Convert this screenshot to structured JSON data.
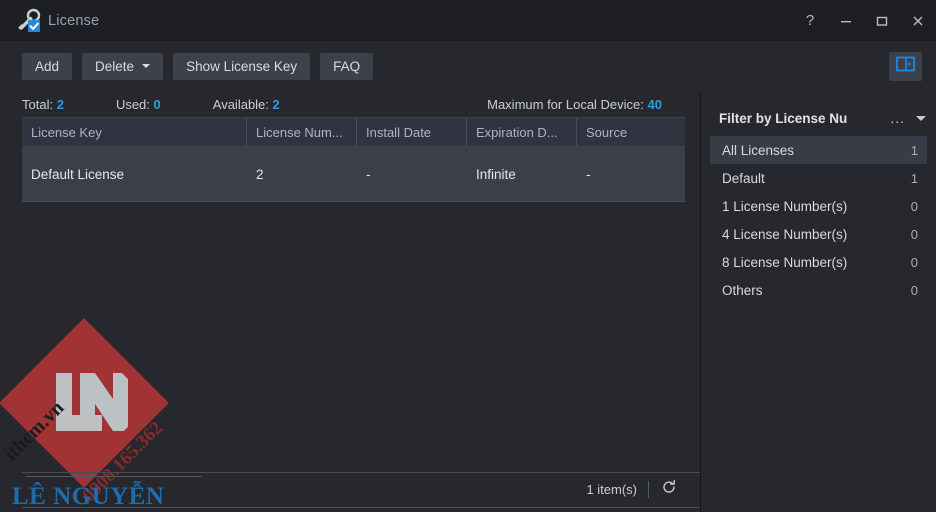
{
  "window": {
    "title": "License",
    "icon": "key-check-icon",
    "controls": {
      "help": "?",
      "minimize": "—",
      "maximize": "□",
      "close": "✕"
    }
  },
  "toolbar": {
    "add_label": "Add",
    "delete_label": "Delete",
    "show_license_key_label": "Show License Key",
    "faq_label": "FAQ",
    "panel_toggle_icon": "side-panel-toggle-icon"
  },
  "stats": [
    {
      "label": "Total:",
      "value": "2"
    },
    {
      "label": "Used:",
      "value": "0"
    },
    {
      "label": "Available:",
      "value": "2"
    },
    {
      "label": "Maximum for Local Device:",
      "value": "40"
    }
  ],
  "table": {
    "columns": [
      "License Key",
      "License Num...",
      "Install Date",
      "Expiration D...",
      "Source"
    ],
    "rows": [
      {
        "license_key": "Default License",
        "license_number": "2",
        "install_date": "-",
        "expiration_date": "Infinite",
        "source": "-"
      }
    ]
  },
  "filter_panel": {
    "title": "Filter by License Nu",
    "overflow": "...",
    "items": [
      {
        "label": "All Licenses",
        "count": "1",
        "selected": true
      },
      {
        "label": "Default",
        "count": "1",
        "selected": false
      },
      {
        "label": "1 License Number(s)",
        "count": "0",
        "selected": false
      },
      {
        "label": "4 License Number(s)",
        "count": "0",
        "selected": false
      },
      {
        "label": "8 License Number(s)",
        "count": "0",
        "selected": false
      },
      {
        "label": "Others",
        "count": "0",
        "selected": false
      }
    ]
  },
  "footer": {
    "count_label": "1 item(s)",
    "refresh_icon": "refresh-icon"
  },
  "watermark": {
    "monogram": "LN",
    "site": "ithcm.vn",
    "phone": "0908.165.362",
    "brand": "LÊ NGUYỄN"
  },
  "colors": {
    "accent_blue": "#2a9fe0",
    "titlebar": "#1d1f25",
    "background": "#26282e",
    "row_selected": "#3a3f4a",
    "brand_blue": "#1f6fb2",
    "brand_red": "#b03535"
  }
}
